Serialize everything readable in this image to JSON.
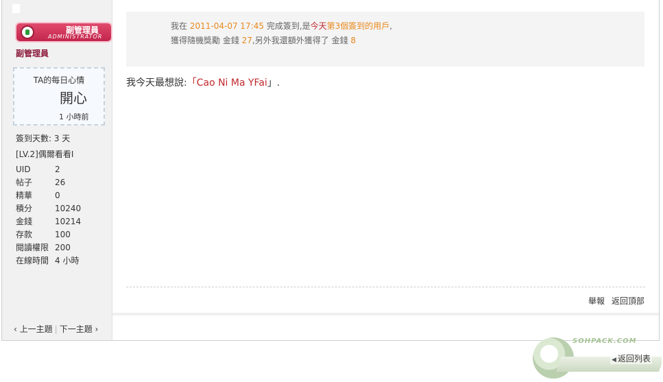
{
  "author": {
    "badge_title": "副管理員",
    "badge_subtitle": "ADMINISTRATOR",
    "group_name": "副管理員",
    "mood": {
      "label": "TA的每日心情",
      "value": "開心",
      "time": "1 小時前"
    },
    "checkin_days": "簽到天數: 3 天",
    "level": "[LV.2]偶爾看看I",
    "stats": [
      {
        "key": "UID",
        "value": "2"
      },
      {
        "key": "帖子",
        "value": "26"
      },
      {
        "key": "精華",
        "value": "0"
      },
      {
        "key": "積分",
        "value": "10240"
      },
      {
        "key": "金錢",
        "value": "10214"
      },
      {
        "key": "存款",
        "value": "100"
      },
      {
        "key": "閱讀權限",
        "value": "200"
      },
      {
        "key": "在線時間",
        "value": "4 小時"
      }
    ]
  },
  "thread_nav": {
    "prev": "上一主題",
    "next": "下一主題"
  },
  "notice": {
    "p1": "我在",
    "datetime": "2011-04-07 17:45",
    "p2": "完成簽到,是",
    "today": "今天",
    "rank": "第3個簽到的用戶",
    "p3": ",獲得隨機獎勵 金錢",
    "reward": "27",
    "p4": ",另外我還額外獲得了 金錢",
    "extra": "8"
  },
  "message": {
    "prefix": "我今天最想說:",
    "open_quote": "「",
    "quote": "Cao Ni Ma YFai",
    "close_quote": "」."
  },
  "post_actions": {
    "report": "舉報",
    "back_to_top": "返回頂部"
  },
  "footer": {
    "watermark_text": "SOHPACK.COM",
    "back_to_list": "返回列表"
  },
  "colors": {
    "badge": "#c2254b",
    "highlight": "#e8891e",
    "quote": "#c0282d"
  }
}
